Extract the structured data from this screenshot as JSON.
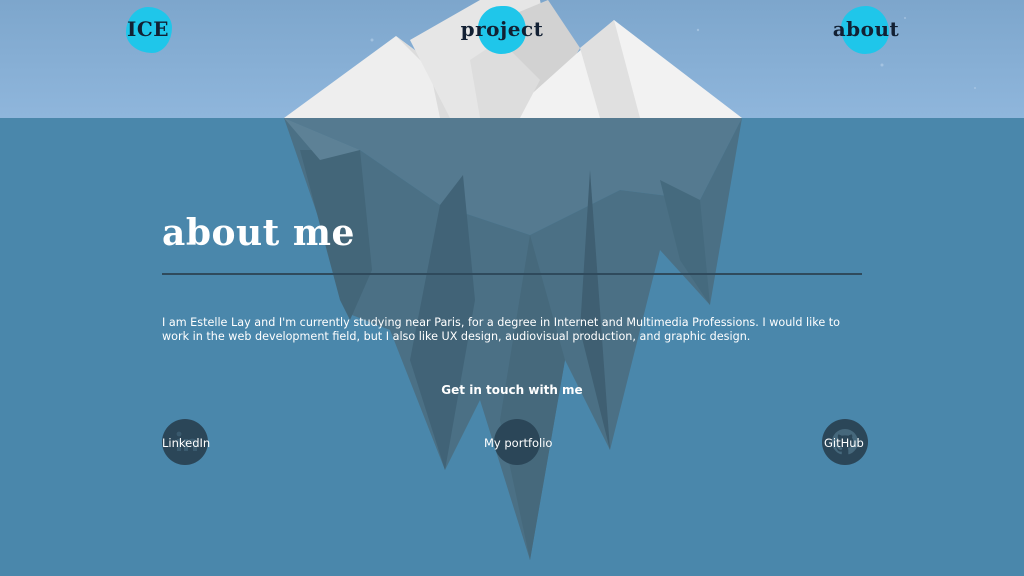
{
  "nav": {
    "home_label": "ICE",
    "project_label": "project",
    "about_label": "about"
  },
  "about": {
    "title": "about me",
    "bio": "I am Estelle Lay and I'm currently studying near Paris, for a degree in Internet and Multimedia Professions. I would like to work in the web development field, but I also like UX design, audiovisual production, and graphic design."
  },
  "contact": {
    "heading": "Get in touch with me",
    "links": [
      {
        "label": "LinkedIn",
        "icon": "linkedin-icon"
      },
      {
        "label": "My portfolio",
        "icon": "portfolio-icon"
      },
      {
        "label": "GitHub",
        "icon": "github-icon"
      }
    ]
  },
  "colors": {
    "sky": "#86aed2",
    "sea": "#4a87ab",
    "accent": "#1fc6ea"
  }
}
